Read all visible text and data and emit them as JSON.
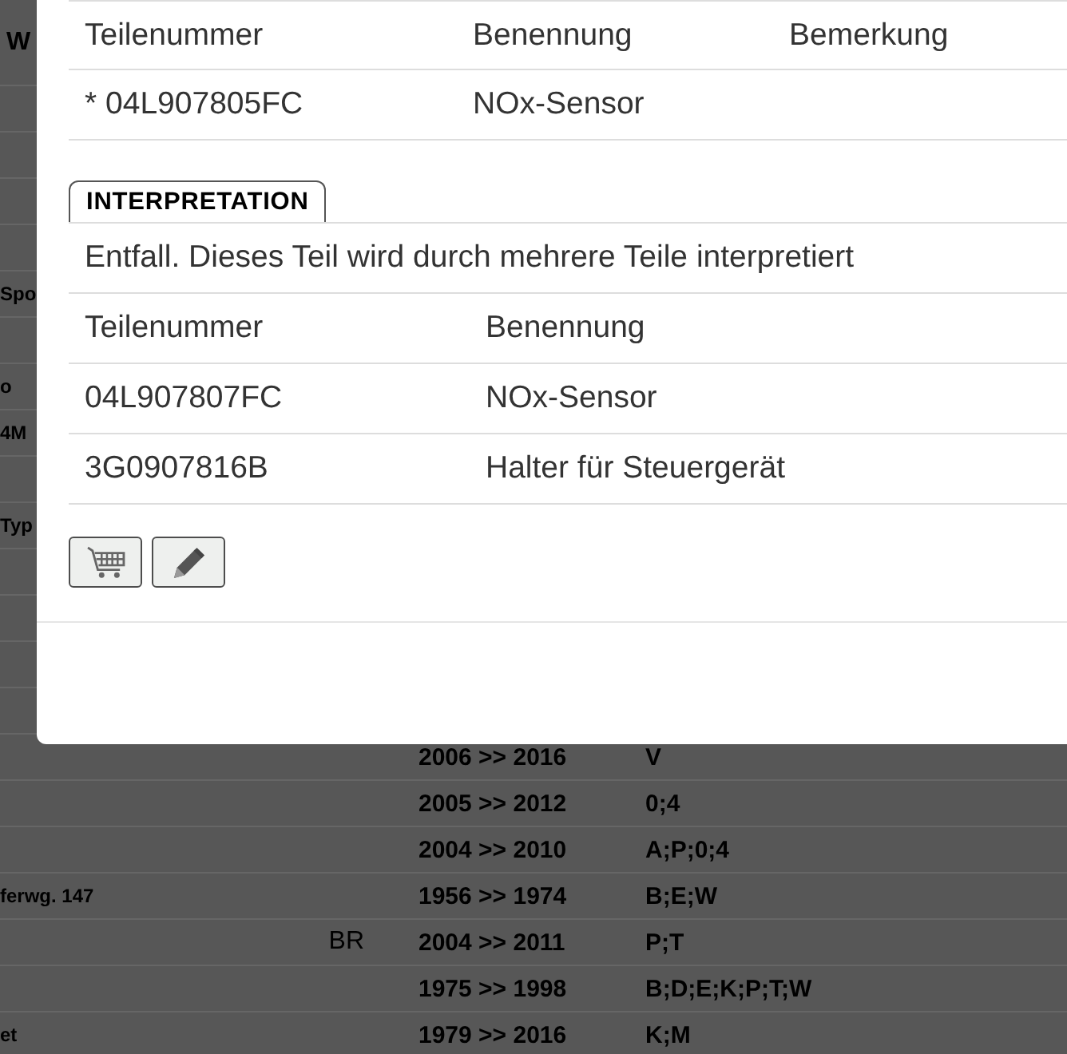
{
  "backdrop_table": {
    "header_cell": "W",
    "rows": [
      {},
      {},
      {},
      {},
      {
        "column_1": "Spo"
      },
      {},
      {
        "column_1": "o"
      },
      {
        "column_1": "4M"
      },
      {},
      {
        "column_1": "Typ"
      },
      {},
      {},
      {},
      {},
      {
        "column_3": "2006 >> 2016",
        "column_4": "V"
      },
      {
        "column_3": "2005 >> 2012",
        "column_4": "0;4"
      },
      {
        "column_3": "2004 >> 2010",
        "column_4": "A;P;0;4"
      },
      {
        "column_1": "ferwg. 147",
        "column_3": "1956 >> 1974",
        "column_4": "B;E;W"
      },
      {
        "column_2": "BR",
        "column_3": "2004 >> 2011",
        "column_4": "P;T"
      },
      {
        "column_3": "1975 >> 1998",
        "column_4": "B;D;E;K;P;T;W"
      },
      {
        "column_1": "et",
        "column_3": "1979 >> 2016",
        "column_4": "K;M"
      }
    ]
  },
  "dialog": {
    "parts_table": {
      "columns": [
        "Teilenummer",
        "Benennung",
        "Bemerkung"
      ],
      "rows": [
        [
          "* 04L907805FC",
          "NOx-Sensor"
        ]
      ]
    },
    "tab": {
      "label": "INTERPRETATION"
    },
    "note": "Entfall. Dieses Teil wird durch mehrere Teile interpretiert",
    "interpretation_table": {
      "columns": [
        "Teilenummer",
        "Benennung"
      ],
      "rows": [
        [
          "04L907807FC",
          "NOx-Sensor"
        ],
        [
          "3G0907816B",
          "Halter für Steuergerät"
        ]
      ]
    },
    "buttons": [
      {
        "kind": "cart"
      },
      {
        "kind": "edit"
      }
    ]
  }
}
